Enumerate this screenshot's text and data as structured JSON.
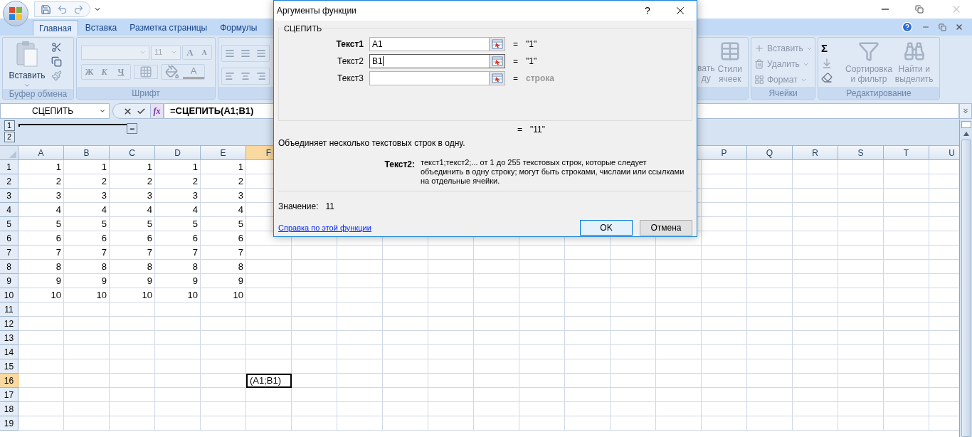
{
  "tabs": [
    {
      "label": "Главная",
      "selected": true
    },
    {
      "label": "Вставка",
      "selected": false
    },
    {
      "label": "Разметка страницы",
      "selected": false
    },
    {
      "label": "Формулы",
      "selected": false
    }
  ],
  "ribbon": {
    "clipboard": {
      "title": "Буфер обмена",
      "paste": "Вставить"
    },
    "font": {
      "title": "Шрифт",
      "font_size": "11",
      "grow": "A",
      "shrink": "A",
      "bold": "Ж",
      "italic": "К",
      "underline": "Ч",
      "font_color": "A"
    },
    "styles": {
      "format_table_partial": [
        "вать",
        "ду"
      ],
      "cell_styles": [
        "Стили",
        "ячеек"
      ]
    },
    "cells": {
      "title": "Ячейки",
      "items": [
        "Вставить",
        "Удалить",
        "Формат"
      ]
    },
    "editing": {
      "title": "Редактирование",
      "sum": "Σ",
      "sort": [
        "Сортировка",
        "и фильтр"
      ],
      "find": [
        "Найти и",
        "выделить"
      ]
    }
  },
  "formula_bar": {
    "name_box": "СЦЕПИТЬ",
    "fx": "fx",
    "formula": "=СЦЕПИТЬ(A1;B1)"
  },
  "outline": {
    "levels": [
      "1",
      "2"
    ],
    "collapse": "−"
  },
  "sheet": {
    "columns_left": [
      {
        "label": "A",
        "selected": false
      },
      {
        "label": "B",
        "selected": false
      },
      {
        "label": "C",
        "selected": false
      },
      {
        "label": "D",
        "selected": false
      },
      {
        "label": "E",
        "selected": false
      },
      {
        "label": "F",
        "selected": true
      }
    ],
    "columns_right": [
      {
        "label": "P",
        "selected": false
      },
      {
        "label": "Q",
        "selected": false
      },
      {
        "label": "R",
        "selected": false
      },
      {
        "label": "S",
        "selected": false
      },
      {
        "label": "T",
        "selected": false
      },
      {
        "label": "U",
        "selected": false
      }
    ],
    "rows": [
      {
        "label": "1",
        "selected": false,
        "cells": [
          {
            "text": "1",
            "selected": false
          },
          {
            "text": "1",
            "selected": false
          },
          {
            "text": "1",
            "selected": false
          },
          {
            "text": "1",
            "selected": false
          },
          {
            "text": "1",
            "selected": false
          }
        ]
      },
      {
        "label": "2",
        "selected": false,
        "cells": [
          {
            "text": "2",
            "selected": false
          },
          {
            "text": "2",
            "selected": false
          },
          {
            "text": "2",
            "selected": false
          },
          {
            "text": "2",
            "selected": false
          },
          {
            "text": "2",
            "selected": false
          }
        ]
      },
      {
        "label": "3",
        "selected": false,
        "cells": [
          {
            "text": "3",
            "selected": false
          },
          {
            "text": "3",
            "selected": false
          },
          {
            "text": "3",
            "selected": false
          },
          {
            "text": "3",
            "selected": false
          },
          {
            "text": "3",
            "selected": false
          }
        ]
      },
      {
        "label": "4",
        "selected": false,
        "cells": [
          {
            "text": "4",
            "selected": false
          },
          {
            "text": "4",
            "selected": false
          },
          {
            "text": "4",
            "selected": false
          },
          {
            "text": "4",
            "selected": false
          },
          {
            "text": "4",
            "selected": false
          }
        ]
      },
      {
        "label": "5",
        "selected": false,
        "cells": [
          {
            "text": "5",
            "selected": false
          },
          {
            "text": "5",
            "selected": false
          },
          {
            "text": "5",
            "selected": false
          },
          {
            "text": "5",
            "selected": false
          },
          {
            "text": "5",
            "selected": false
          }
        ]
      },
      {
        "label": "6",
        "selected": false,
        "cells": [
          {
            "text": "6",
            "selected": false
          },
          {
            "text": "6",
            "selected": false
          },
          {
            "text": "6",
            "selected": false
          },
          {
            "text": "6",
            "selected": false
          },
          {
            "text": "6",
            "selected": false
          }
        ]
      },
      {
        "label": "7",
        "selected": false,
        "cells": [
          {
            "text": "7",
            "selected": false
          },
          {
            "text": "7",
            "selected": false
          },
          {
            "text": "7",
            "selected": false
          },
          {
            "text": "7",
            "selected": false
          },
          {
            "text": "7",
            "selected": false
          }
        ]
      },
      {
        "label": "8",
        "selected": false,
        "cells": [
          {
            "text": "8",
            "selected": false
          },
          {
            "text": "8",
            "selected": false
          },
          {
            "text": "8",
            "selected": false
          },
          {
            "text": "8",
            "selected": false
          },
          {
            "text": "8",
            "selected": false
          }
        ]
      },
      {
        "label": "9",
        "selected": false,
        "cells": [
          {
            "text": "9",
            "selected": false
          },
          {
            "text": "9",
            "selected": false
          },
          {
            "text": "9",
            "selected": false
          },
          {
            "text": "9",
            "selected": false
          },
          {
            "text": "9",
            "selected": false
          }
        ]
      },
      {
        "label": "10",
        "selected": false,
        "cells": [
          {
            "text": "10",
            "selected": false
          },
          {
            "text": "10",
            "selected": false
          },
          {
            "text": "10",
            "selected": false
          },
          {
            "text": "10",
            "selected": false
          },
          {
            "text": "10",
            "selected": false
          }
        ]
      },
      {
        "label": "11",
        "selected": false
      },
      {
        "label": "12",
        "selected": false
      },
      {
        "label": "13",
        "selected": false
      },
      {
        "label": "14",
        "selected": false
      },
      {
        "label": "15",
        "selected": false
      },
      {
        "label": "16",
        "selected": true,
        "cells": [
          null,
          null,
          null,
          null,
          null,
          {
            "text": "(A1;B1)",
            "selected": true
          }
        ]
      },
      {
        "label": "17",
        "selected": false
      },
      {
        "label": "18",
        "selected": false
      },
      {
        "label": "19",
        "selected": false
      }
    ]
  },
  "dialog": {
    "title": "Аргументы функции",
    "help": "?",
    "function_name": "СЦЕПИТЬ",
    "args": [
      {
        "label": "Текст1",
        "required": true,
        "value": "A1",
        "focused": false,
        "eq": "=",
        "result": "\"1\"",
        "muted": false
      },
      {
        "label": "Текст2",
        "required": false,
        "value": "B1",
        "focused": true,
        "eq": "=",
        "result": "\"1\"",
        "muted": false
      },
      {
        "label": "Текст3",
        "required": false,
        "focused": false,
        "eq": "=",
        "result": "строка",
        "muted": true
      }
    ],
    "total": {
      "eq": "=",
      "result": "\"11\""
    },
    "description": "Объединяет несколько текстовых строк в одну.",
    "arg_help": {
      "label": "Текст2:",
      "text": "текст1;текст2;... от 1 до 255 текстовых строк, которые следует объединить в одну строку; могут быть строками, числами или ссылками на отдельные ячейки."
    },
    "value_label": "Значение:",
    "value": "11",
    "link": "Справка по этой функции",
    "buttons": [
      {
        "label": "OK",
        "default": true
      },
      {
        "label": "Отмена",
        "default": false
      }
    ]
  }
}
